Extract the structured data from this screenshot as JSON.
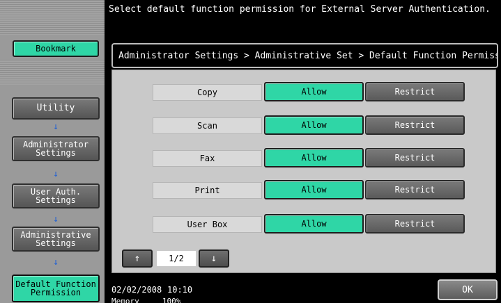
{
  "message": "Select default function permission for External Server Authentication.",
  "breadcrumb": "Administrator Settings > Administrative Set > Default Function Permission",
  "sidebar": {
    "bookmark": "Bookmark",
    "utility": "Utility",
    "administrator_settings": "Administrator\nSettings",
    "user_auth_settings": "User Auth.\nSettings",
    "administrative_settings": "Administrative\nSettings",
    "default_function_permission": "Default Function\nPermission",
    "arrow": "↓"
  },
  "permissions": [
    {
      "label": "Copy",
      "allow": "Allow",
      "restrict": "Restrict",
      "selected": "Allow"
    },
    {
      "label": "Scan",
      "allow": "Allow",
      "restrict": "Restrict",
      "selected": "Allow"
    },
    {
      "label": "Fax",
      "allow": "Allow",
      "restrict": "Restrict",
      "selected": "Allow"
    },
    {
      "label": "Print",
      "allow": "Allow",
      "restrict": "Restrict",
      "selected": "Allow"
    },
    {
      "label": "User Box",
      "allow": "Allow",
      "restrict": "Restrict",
      "selected": "Allow"
    }
  ],
  "pager": {
    "up": "↑",
    "down": "↓",
    "page": "1/2"
  },
  "status": {
    "date": "02/02/2008",
    "time": "10:10",
    "memory_label": "Memory",
    "memory_value": "100%"
  },
  "ok": "OK",
  "colors": {
    "accent": "#2fd6a6",
    "arrow": "#1c5fd6"
  }
}
